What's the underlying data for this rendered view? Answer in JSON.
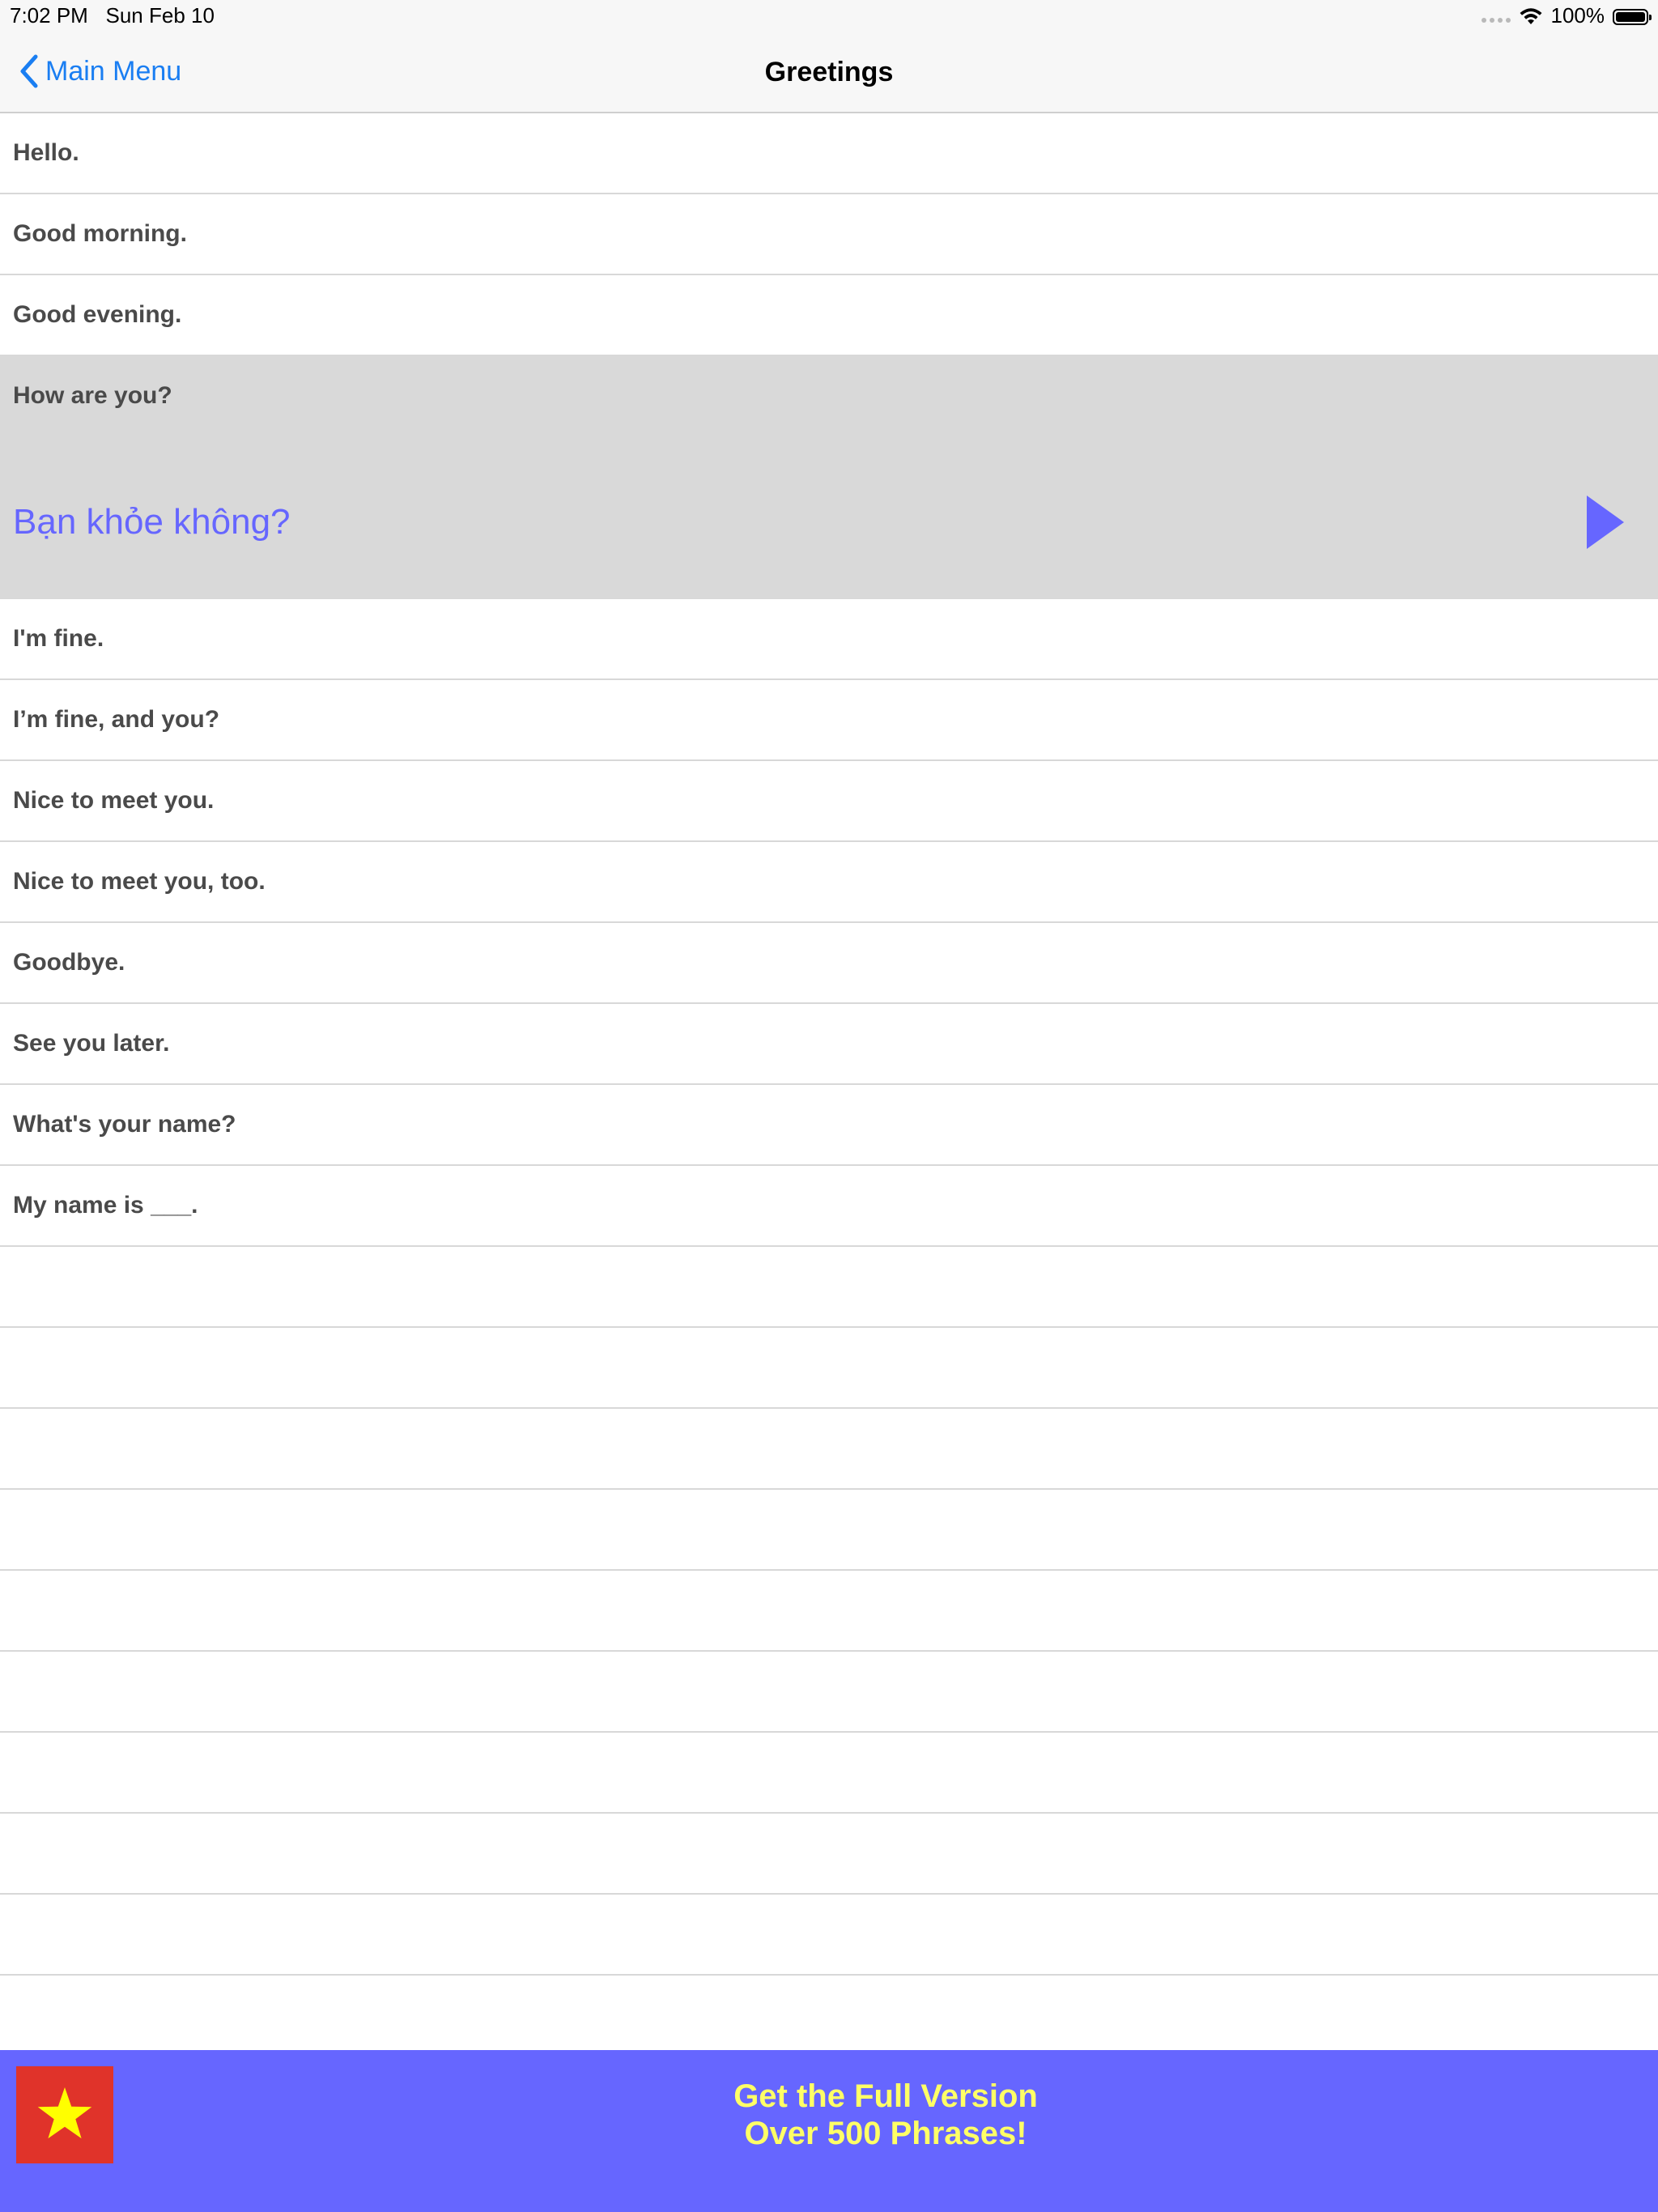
{
  "status_bar": {
    "time_date": "7:02 PM   Sun Feb 10",
    "battery": "100%",
    "icons": [
      "signal-dots-icon",
      "wifi-icon",
      "battery-icon"
    ]
  },
  "nav": {
    "back_label": "Main Menu",
    "title": "Greetings"
  },
  "phrases": [
    {
      "en": "Hello."
    },
    {
      "en": "Good morning."
    },
    {
      "en": "Good evening."
    },
    {
      "en": "How are you?",
      "vi": "Bạn khỏe không?",
      "expanded": true
    },
    {
      "en": "I'm fine."
    },
    {
      "en": "I’m fine, and you?"
    },
    {
      "en": "Nice to meet you."
    },
    {
      "en": "Nice to meet you, too."
    },
    {
      "en": "Goodbye."
    },
    {
      "en": "See you later."
    },
    {
      "en": "What's your name?"
    },
    {
      "en": "My name is ___."
    }
  ],
  "banner": {
    "line1": "Get the Full Version",
    "line2": "Over 500 Phrases!",
    "flag_icon": "vietnam-flag-icon"
  },
  "colors": {
    "accent_blue": "#1a7ef2",
    "translation": "#6666ff",
    "banner_bg": "#6666ff",
    "banner_text": "#ffff66",
    "flag_red": "#e0332a",
    "flag_star": "#ffff00",
    "expanded_row_bg": "#d9d9d9"
  }
}
